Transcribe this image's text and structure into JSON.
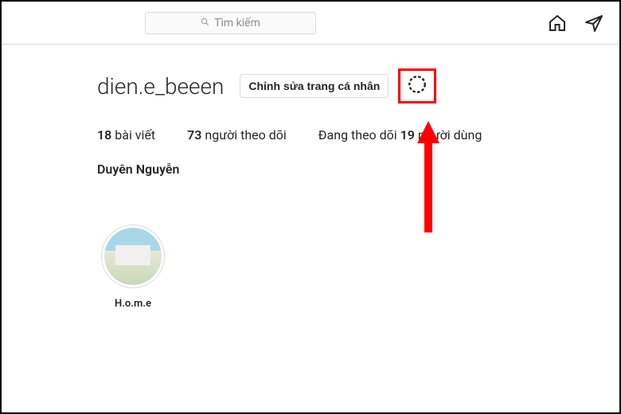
{
  "search": {
    "placeholder": "Tìm kiếm"
  },
  "profile": {
    "username": "dien.e_beeen",
    "edit_button_label": "Chỉnh sửa trang cá nhân",
    "display_name": "Duyên Nguyễn"
  },
  "stats": {
    "posts_count": "18",
    "posts_label": "bài viết",
    "followers_count": "73",
    "followers_label": "người theo dõi",
    "following_prefix": "Đang theo dõi",
    "following_count": "19",
    "following_suffix": "người dùng"
  },
  "highlights": [
    {
      "label": "H.o.m.e"
    }
  ],
  "annotation": {
    "highlight_color": "#ff0000"
  }
}
